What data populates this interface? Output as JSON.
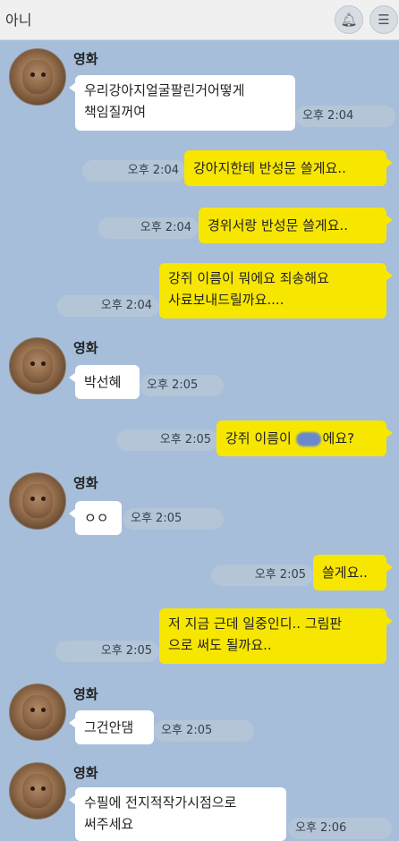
{
  "header": {
    "title": "아니",
    "bell_icon": "bell-icon",
    "menu_icon": "menu-icon"
  },
  "sender": "영화",
  "messages": [
    {
      "dir": "in",
      "lines": [
        "우리강아지얼굴팔린거어떻게",
        "책임질꺼여"
      ],
      "time": "오후 2:04"
    },
    {
      "dir": "out",
      "text": "강아지한테 반성문 쓸게요..",
      "time": "오후 2:04"
    },
    {
      "dir": "out",
      "text": "경위서랑 반성문 쓸게요..",
      "time": "오후 2:04"
    },
    {
      "dir": "out",
      "lines": [
        "강쥐 이름이 뭐에요 죄송해요",
        "사료보내드릴까요...."
      ],
      "time": "오후 2:04"
    },
    {
      "dir": "in",
      "text": "박선혜",
      "time": "오후 2:05"
    },
    {
      "dir": "out",
      "text_before": "강쥐 이름이 ",
      "text_after": "에요?",
      "time": "오후 2:05"
    },
    {
      "dir": "in",
      "text": "ㅇㅇ",
      "time": "오후 2:05"
    },
    {
      "dir": "out",
      "text": "쓸게요..",
      "time": "오후 2:05"
    },
    {
      "dir": "out",
      "lines": [
        "저 지금 근데 일중인디.. 그림판",
        "으로 써도 될까요.."
      ],
      "time": "오후 2:05"
    },
    {
      "dir": "in",
      "text": "그건안댐",
      "time": "오후 2:05"
    },
    {
      "dir": "in",
      "lines": [
        "수필에 전지적작가시점으로",
        "써주세요"
      ],
      "time": "오후 2:06"
    }
  ]
}
